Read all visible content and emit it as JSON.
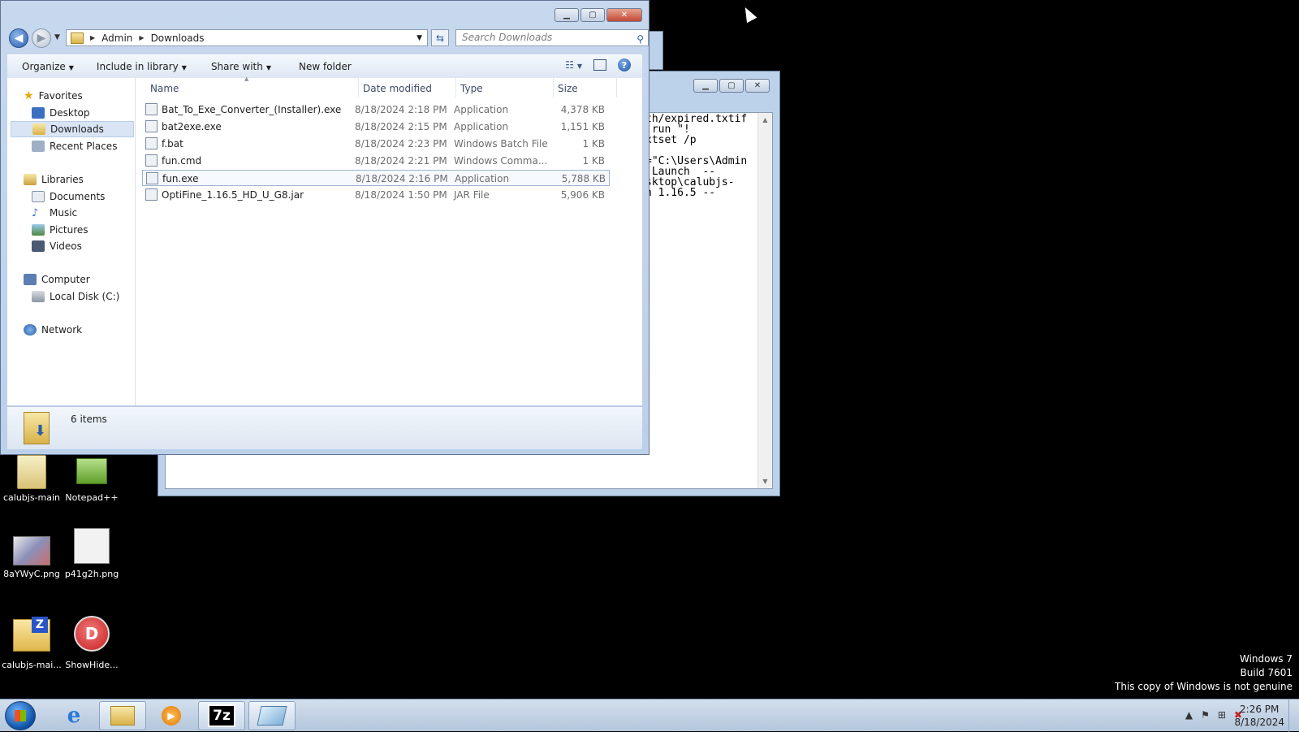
{
  "desktop": {
    "icons": [
      {
        "label": "calubjs-main"
      },
      {
        "label": "Notepad++"
      },
      {
        "label": "8aYWyC.png"
      },
      {
        "label": "p41g2h.png"
      },
      {
        "label": "calubjs-mai..."
      },
      {
        "label": "ShowHide..."
      }
    ],
    "watermark": {
      "line1": "Windows 7",
      "line2": "Build 7601",
      "line3": "This copy of Windows is not genuine"
    }
  },
  "console": {
    "lines": [
      "th/expired.txtif",
      " run \"!",
      "xtset /p",
      "",
      "=\"C:\\Users\\Admin",
      ".Launch  --",
      "sktop\\calubjs-",
      "n 1.16.5 --"
    ]
  },
  "explorer": {
    "breadcrumb": {
      "seg1": "Admin",
      "seg2": "Downloads"
    },
    "search_placeholder": "Search Downloads",
    "toolbar": {
      "organize": "Organize",
      "include_in_library": "Include in library",
      "share_with": "Share with",
      "new_folder": "New folder"
    },
    "nav": {
      "favorites": "Favorites",
      "desktop": "Desktop",
      "downloads": "Downloads",
      "recent_places": "Recent Places",
      "libraries": "Libraries",
      "documents": "Documents",
      "music": "Music",
      "pictures": "Pictures",
      "videos": "Videos",
      "computer": "Computer",
      "local_disk": "Local Disk (C:)",
      "network": "Network"
    },
    "columns": {
      "name": "Name",
      "date": "Date modified",
      "type": "Type",
      "size": "Size"
    },
    "files": [
      {
        "name": "Bat_To_Exe_Converter_(Installer).exe",
        "date": "8/18/2024 2:18 PM",
        "type": "Application",
        "size": "4,378 KB"
      },
      {
        "name": "bat2exe.exe",
        "date": "8/18/2024 2:15 PM",
        "type": "Application",
        "size": "1,151 KB"
      },
      {
        "name": "f.bat",
        "date": "8/18/2024 2:23 PM",
        "type": "Windows Batch File",
        "size": "1 KB"
      },
      {
        "name": "fun.cmd",
        "date": "8/18/2024 2:21 PM",
        "type": "Windows Comma...",
        "size": "1 KB"
      },
      {
        "name": "fun.exe",
        "date": "8/18/2024 2:16 PM",
        "type": "Application",
        "size": "5,788 KB"
      },
      {
        "name": "OptiFine_1.16.5_HD_U_G8.jar",
        "date": "8/18/2024 1:50 PM",
        "type": "JAR File",
        "size": "5,906 KB"
      }
    ],
    "status": "6 items"
  },
  "taskbar": {
    "apps": [
      "7z"
    ],
    "clock": {
      "time": "2:26 PM",
      "date": "8/18/2024"
    }
  }
}
